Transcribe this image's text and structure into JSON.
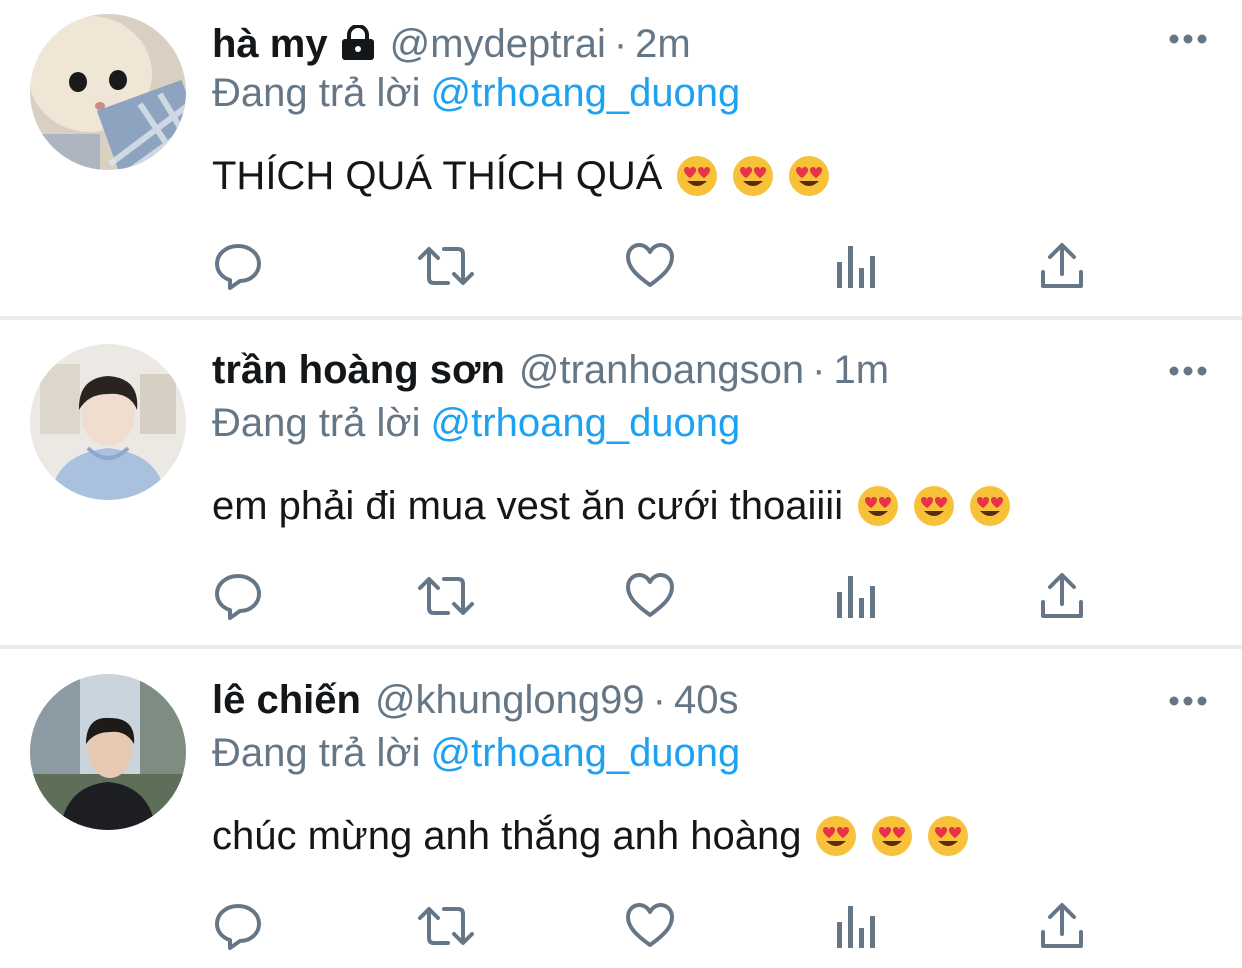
{
  "tweets": [
    {
      "display_name": "hà my",
      "protected": true,
      "handle": "@mydeptrai",
      "separator": "·",
      "time": "2m",
      "reply_prefix": "Đang trả lời",
      "reply_to": "@trhoang_duong",
      "text": "THÍCH QUÁ THÍCH QUÁ",
      "emojis": [
        "heart-eyes",
        "heart-eyes",
        "heart-eyes"
      ]
    },
    {
      "display_name": "trần hoàng sơn",
      "protected": false,
      "handle": "@tranhoangson",
      "separator": "·",
      "time": "1m",
      "reply_prefix": "Đang trả lời",
      "reply_to": "@trhoang_duong",
      "text": "em phải đi mua vest ăn cưới thoaiiii",
      "emojis": [
        "heart-eyes",
        "heart-eyes",
        "heart-eyes"
      ]
    },
    {
      "display_name": "lê chiến",
      "protected": false,
      "handle": "@khunglong99",
      "separator": "·",
      "time": "40s",
      "reply_prefix": "Đang trả lời",
      "reply_to": "@trhoang_duong",
      "text": "chúc mừng anh thắng anh hoàng",
      "emojis": [
        "heart-eyes",
        "heart-eyes",
        "heart-eyes"
      ]
    }
  ],
  "action_icons": [
    "reply-icon",
    "retweet-icon",
    "like-icon",
    "analytics-icon",
    "share-icon"
  ],
  "colors": {
    "text": "#14171a",
    "secondary": "#657786",
    "link": "#1da1f2",
    "icon": "#657786",
    "divider": "#e6ecf0"
  }
}
